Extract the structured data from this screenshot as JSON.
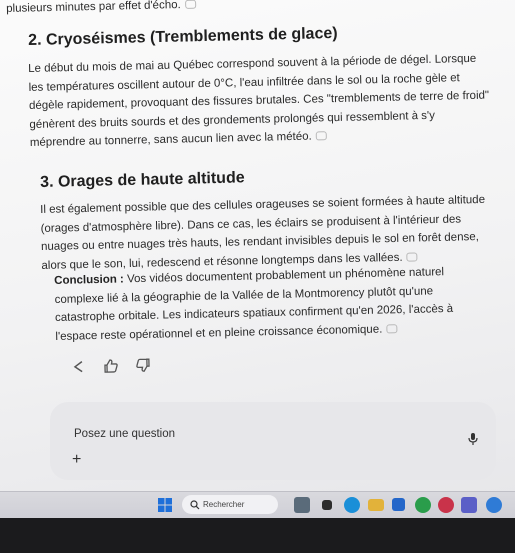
{
  "article": {
    "top_fragment": "plusieurs minutes par effet d'écho.",
    "sections": [
      {
        "heading": "2. Cryoséismes (Tremblements de glace)",
        "body": "Le début du mois de mai au Québec correspond souvent à la période de dégel. Lorsque les températures oscillent autour de 0°C, l'eau infiltrée dans le sol ou la roche gèle et dégèle rapidement, provoquant des fissures brutales. Ces \"tremblements de terre de froid\" génèrent des bruits sourds et des grondements prolongés qui ressemblent à s'y méprendre au tonnerre, sans aucun lien avec la météo."
      },
      {
        "heading": "3. Orages de haute altitude",
        "body": "Il est également possible que des cellules orageuses se soient formées à haute altitude (orages d'atmosphère libre). Dans ce cas, les éclairs se produisent à l'intérieur des nuages ou entre nuages très hauts, les rendant invisibles depuis le sol en forêt dense, alors que le son, lui, redescend et résonne longtemps dans les vallées."
      }
    ],
    "conclusion_label": "Conclusion :",
    "conclusion_text": " Vos vidéos documentent probablement un phénomène naturel complexe lié à la géographie de la Vallée de la Montmorency plutôt qu'une catastrophe orbitale. Les indicateurs spatiaux confirment qu'en 2026, l'accès à l'espace reste opérationnel et en pleine croissance économique."
  },
  "actions": [
    {
      "name": "share",
      "icon": "share-icon"
    },
    {
      "name": "like",
      "icon": "thumbs-up-icon"
    },
    {
      "name": "dislike",
      "icon": "thumbs-down-icon"
    }
  ],
  "composer": {
    "placeholder": "Posez une question",
    "plus_label": "+",
    "mic_icon": "microphone-icon"
  },
  "taskbar": {
    "search_label": "Rechercher",
    "colors": {
      "start": "#1e6fd9",
      "bar": "#d3d3d9"
    },
    "apps": [
      {
        "icon": "widgets-icon",
        "color": "#5a6b7a"
      },
      {
        "icon": "task-view-icon",
        "color": "#2c2c2c"
      },
      {
        "icon": "edge-icon",
        "color": "#1a8fd8"
      },
      {
        "icon": "file-explorer-icon",
        "color": "#e2b23a"
      },
      {
        "icon": "store-icon",
        "color": "#2466c9"
      },
      {
        "icon": "chrome-icon",
        "color": "#2a9d4b"
      },
      {
        "icon": "app-icon",
        "color": "#c9334a"
      },
      {
        "icon": "teams-icon",
        "color": "#5b5fc7"
      },
      {
        "icon": "app-icon-2",
        "color": "#2f7bd6"
      }
    ]
  }
}
